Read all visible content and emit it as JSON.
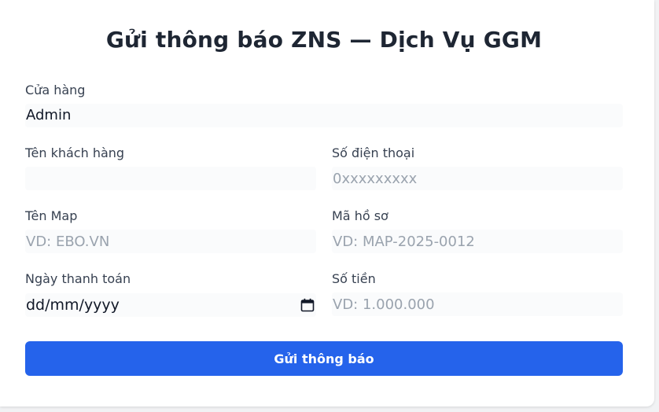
{
  "form": {
    "title": "Gửi thông báo ZNS — Dịch Vụ GGM",
    "store": {
      "label": "Cửa hàng",
      "value": "Admin"
    },
    "customer_name": {
      "label": "Tên khách hàng",
      "value": "",
      "placeholder": ""
    },
    "phone": {
      "label": "Số điện thoại",
      "value": "",
      "placeholder": "0xxxxxxxxx"
    },
    "map_name": {
      "label": "Tên Map",
      "value": "",
      "placeholder": "VD: EBO.VN"
    },
    "record_id": {
      "label": "Mã hồ sơ",
      "value": "",
      "placeholder": "VD: MAP-2025-0012"
    },
    "payment_date": {
      "label": "Ngày thanh toán",
      "value": "dd/mm/yyyy",
      "icon": "calendar-icon"
    },
    "amount": {
      "label": "Số tiền",
      "value": "",
      "placeholder": "VD: 1.000.000"
    },
    "submit_label": "Gửi thông báo"
  },
  "colors": {
    "primary": "#2563eb",
    "title": "#1e2633",
    "placeholder": "#9aa3ae",
    "field_bg": "#fafbfc"
  }
}
